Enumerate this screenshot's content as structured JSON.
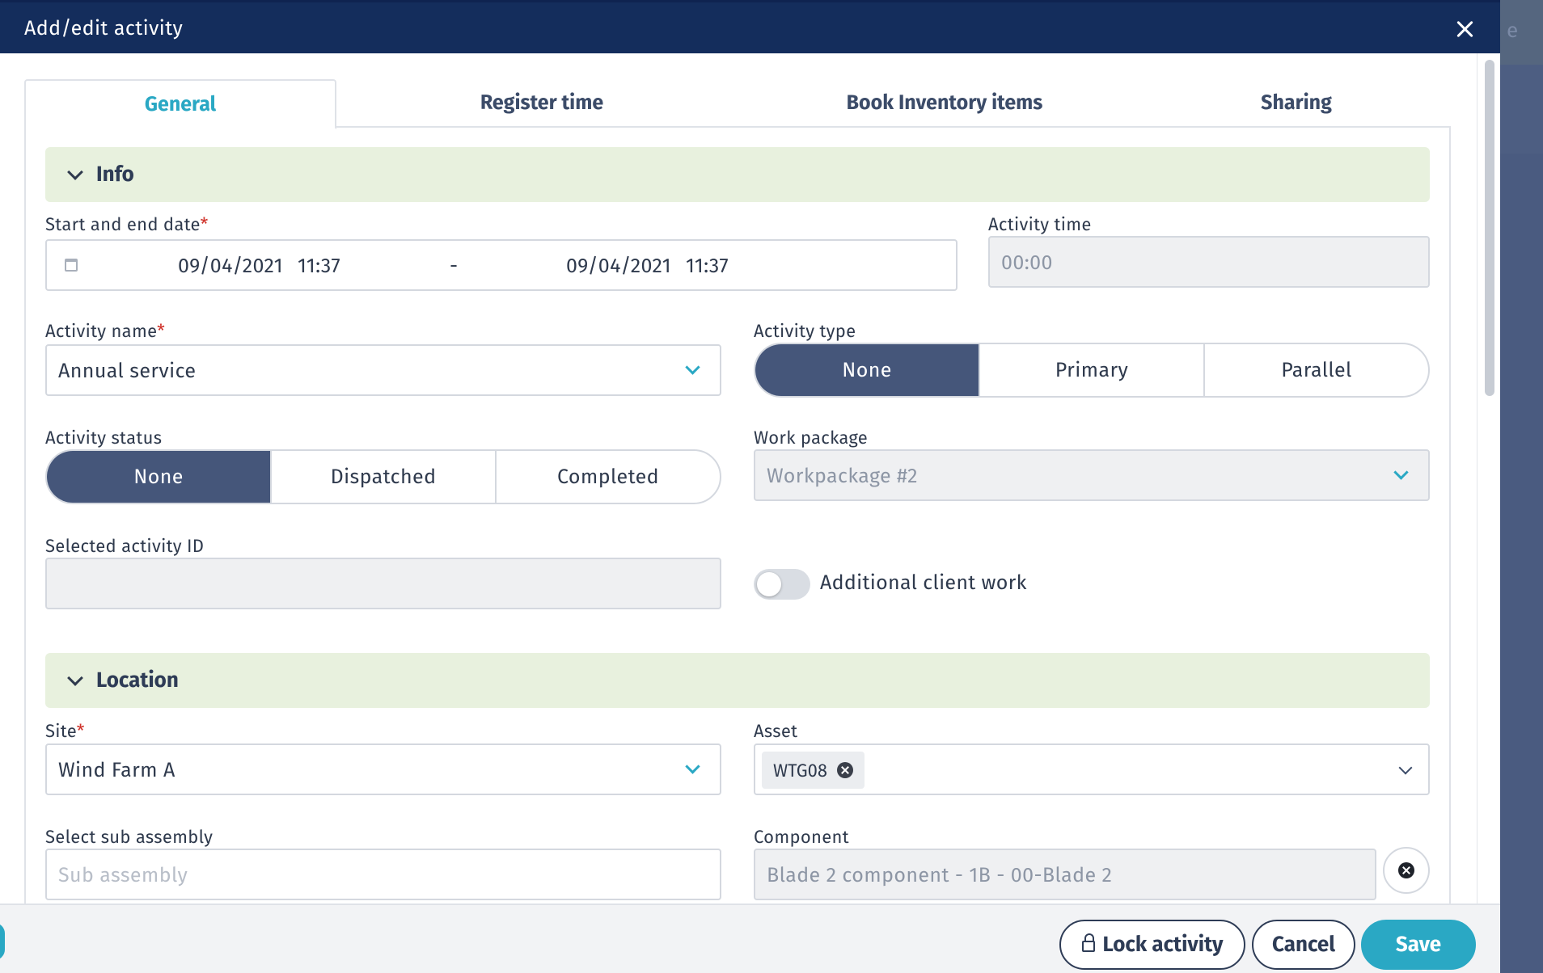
{
  "modal": {
    "title": "Add/edit activity"
  },
  "backdrop": {
    "char": "e"
  },
  "tabs": [
    {
      "label": "General",
      "active": true
    },
    {
      "label": "Register time",
      "active": false
    },
    {
      "label": "Book Inventory items",
      "active": false
    },
    {
      "label": "Sharing",
      "active": false
    }
  ],
  "sections": {
    "info": {
      "title": "Info"
    },
    "location": {
      "title": "Location"
    }
  },
  "info": {
    "start_end_label": "Start and end date",
    "required_mark": "*",
    "start_date": "09/04/2021",
    "start_time": "11:37",
    "range_separator": "-",
    "end_date": "09/04/2021",
    "end_time": "11:37",
    "activity_time_label": "Activity time",
    "activity_time_value": "00:00",
    "activity_name_label": "Activity name",
    "activity_name_value": "Annual service",
    "activity_type_label": "Activity type",
    "activity_type_options": [
      "None",
      "Primary",
      "Parallel"
    ],
    "activity_type_selected": "None",
    "activity_status_label": "Activity status",
    "activity_status_options": [
      "None",
      "Dispatched",
      "Completed"
    ],
    "activity_status_selected": "None",
    "work_package_label": "Work package",
    "work_package_value": "Workpackage #2",
    "selected_activity_id_label": "Selected activity ID",
    "selected_activity_id_value": "",
    "additional_client_work_label": "Additional client work",
    "additional_client_work_on": false
  },
  "location": {
    "site_label": "Site",
    "site_value": "Wind Farm A",
    "asset_label": "Asset",
    "asset_chip": "WTG08",
    "sub_assembly_label": "Select sub assembly",
    "sub_assembly_placeholder": "Sub assembly",
    "component_label": "Component",
    "component_value": "Blade 2 component - 1B - 00-Blade 2"
  },
  "footer": {
    "lock_label": "Lock activity",
    "cancel_label": "Cancel",
    "save_label": "Save"
  },
  "colors": {
    "header_bg": "#142d5c",
    "accent": "#2aa8c4",
    "section_bg": "#e8f1de",
    "segment_active": "#45567a",
    "required": "#d0342c"
  }
}
